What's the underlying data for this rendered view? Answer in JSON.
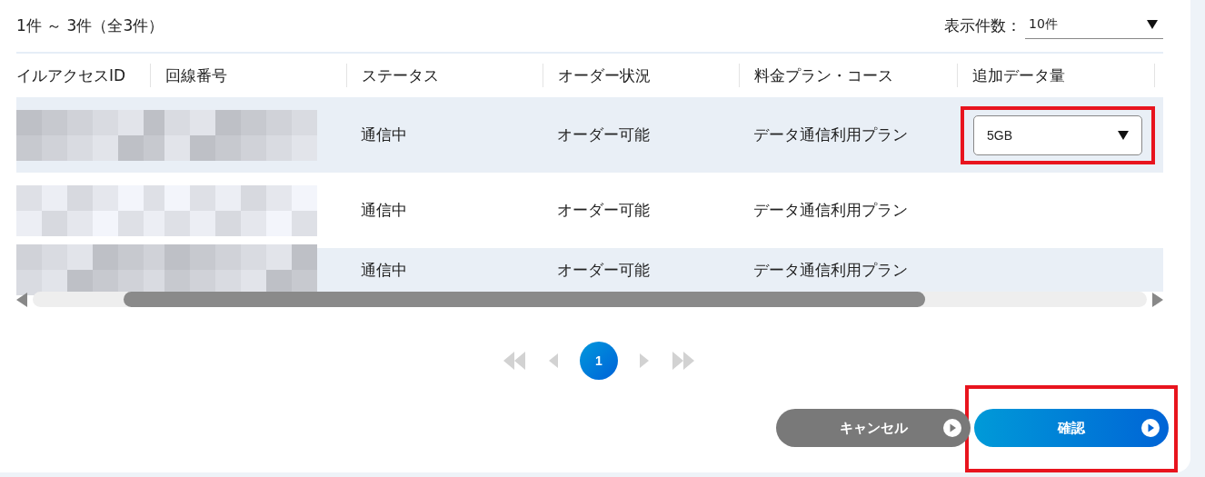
{
  "summary": "1件 ～ 3件（全3件）",
  "page_size": {
    "label": "表示件数：",
    "value": "10件"
  },
  "table": {
    "columns": [
      "イルアクセスID",
      "回線番号",
      "ステータス",
      "オーダー状況",
      "料金プラン・コース",
      "追加データ量"
    ],
    "rows": [
      {
        "selected": true,
        "status": "通信中",
        "order": "オーダー可能",
        "plan": "データ通信利用プラン",
        "addon": {
          "value": "5GB",
          "highlighted": true
        }
      },
      {
        "selected": false,
        "status": "通信中",
        "order": "オーダー可能",
        "plan": "データ通信利用プラン"
      },
      {
        "selected": true,
        "status": "通信中",
        "order": "オーダー可能",
        "plan": "データ通信利用プラン"
      }
    ]
  },
  "pagination": {
    "first_disabled": true,
    "prev_disabled": true,
    "next_disabled": true,
    "last_disabled": true,
    "pages": [
      {
        "label": "1",
        "selected": true
      }
    ]
  },
  "buttons": [
    {
      "kind": "cancel",
      "label": "キャンセル",
      "highlighted": false
    },
    {
      "kind": "confirm",
      "label": "確認",
      "highlighted": true
    }
  ]
}
